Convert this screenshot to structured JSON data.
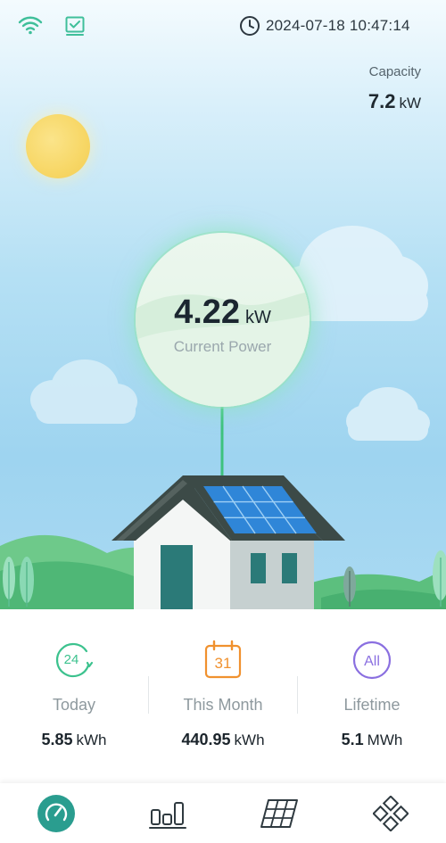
{
  "status_bar": {
    "datetime": "2024-07-18 10:47:14",
    "icons": [
      "wifi-icon",
      "checklist-icon",
      "clock-icon"
    ]
  },
  "capacity": {
    "label": "Capacity",
    "value": "7.2",
    "unit": "kW"
  },
  "current_power": {
    "value": "4.22",
    "unit": "kW",
    "label": "Current Power"
  },
  "stats": [
    {
      "icon": "today-24h-icon",
      "icon_text": "24",
      "label": "Today",
      "value": "5.85",
      "unit": "kWh",
      "color": "#3cc28e"
    },
    {
      "icon": "calendar-month-icon",
      "icon_text": "31",
      "label": "This Month",
      "value": "440.95",
      "unit": "kWh",
      "color": "#f0912e"
    },
    {
      "icon": "lifetime-all-icon",
      "icon_text": "All",
      "label": "Lifetime",
      "value": "5.1",
      "unit": "MWh",
      "color": "#8a6fe0"
    }
  ],
  "nav": [
    {
      "icon": "dashboard-gauge-icon",
      "active": true
    },
    {
      "icon": "bar-chart-icon",
      "active": false
    },
    {
      "icon": "solar-panel-icon",
      "active": false
    },
    {
      "icon": "more-diamonds-icon",
      "active": false
    }
  ],
  "colors": {
    "accent": "#2a9d8f",
    "house_roof": "#3c4a47",
    "solar_panel": "#2f86d8",
    "door": "#2b7a78"
  }
}
